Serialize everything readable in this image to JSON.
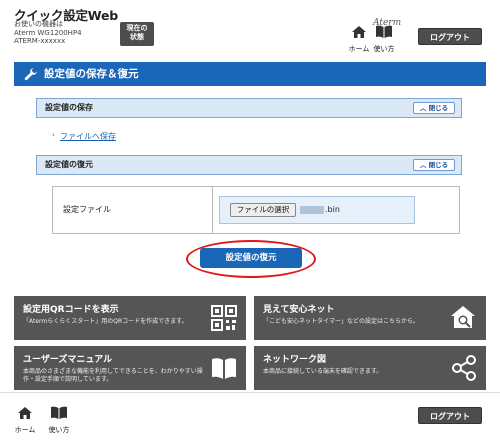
{
  "header": {
    "app_title": "クイック設定Web",
    "device_line1": "お使いの機器は",
    "device_line2": "Aterm WG1200HP4",
    "device_line3": "ATERM-xxxxxx",
    "status_button": "現在の\n状態",
    "home_label": "ホーム",
    "help_label": "使い方",
    "brand": "Aterm",
    "logout_label": "ログアウト"
  },
  "main": {
    "title": "設定値の保存＆復元",
    "save_section": {
      "title": "設定値の保存",
      "close_label": "閉じる",
      "save_link": "ファイルへ保存"
    },
    "restore_section": {
      "title": "設定値の復元",
      "close_label": "閉じる",
      "file_label": "設定ファイル",
      "choose_file_label": "ファイルの選択",
      "file_name_suffix": ".bin"
    },
    "restore_button": "設定値の復元"
  },
  "tiles": [
    {
      "title": "設定用QRコードを表示",
      "desc": "「Atermらくらくスタート」用のQRコードを作成できます。",
      "icon": "qr-code-icon"
    },
    {
      "title": "見えて安心ネット",
      "desc": "「こども安心ネットタイマー」などの設定はこちらから。",
      "icon": "home-search-icon"
    },
    {
      "title": "ユーザーズマニュアル",
      "desc": "本商品のさまざまな機能を利用してできることを、わかりやすい操作・設定手順で説明しています。",
      "icon": "book-icon"
    },
    {
      "title": "ネットワーク図",
      "desc": "本商品に接続している端末を確認できます。",
      "icon": "share-network-icon"
    }
  ],
  "footer": {
    "home_label": "ホーム",
    "help_label": "使い方",
    "logout_label": "ログアウト"
  },
  "colors": {
    "accent": "#1a66b8",
    "section_bg": "#dbe9f7",
    "tile_bg": "#555555",
    "highlight": "#e01818"
  }
}
